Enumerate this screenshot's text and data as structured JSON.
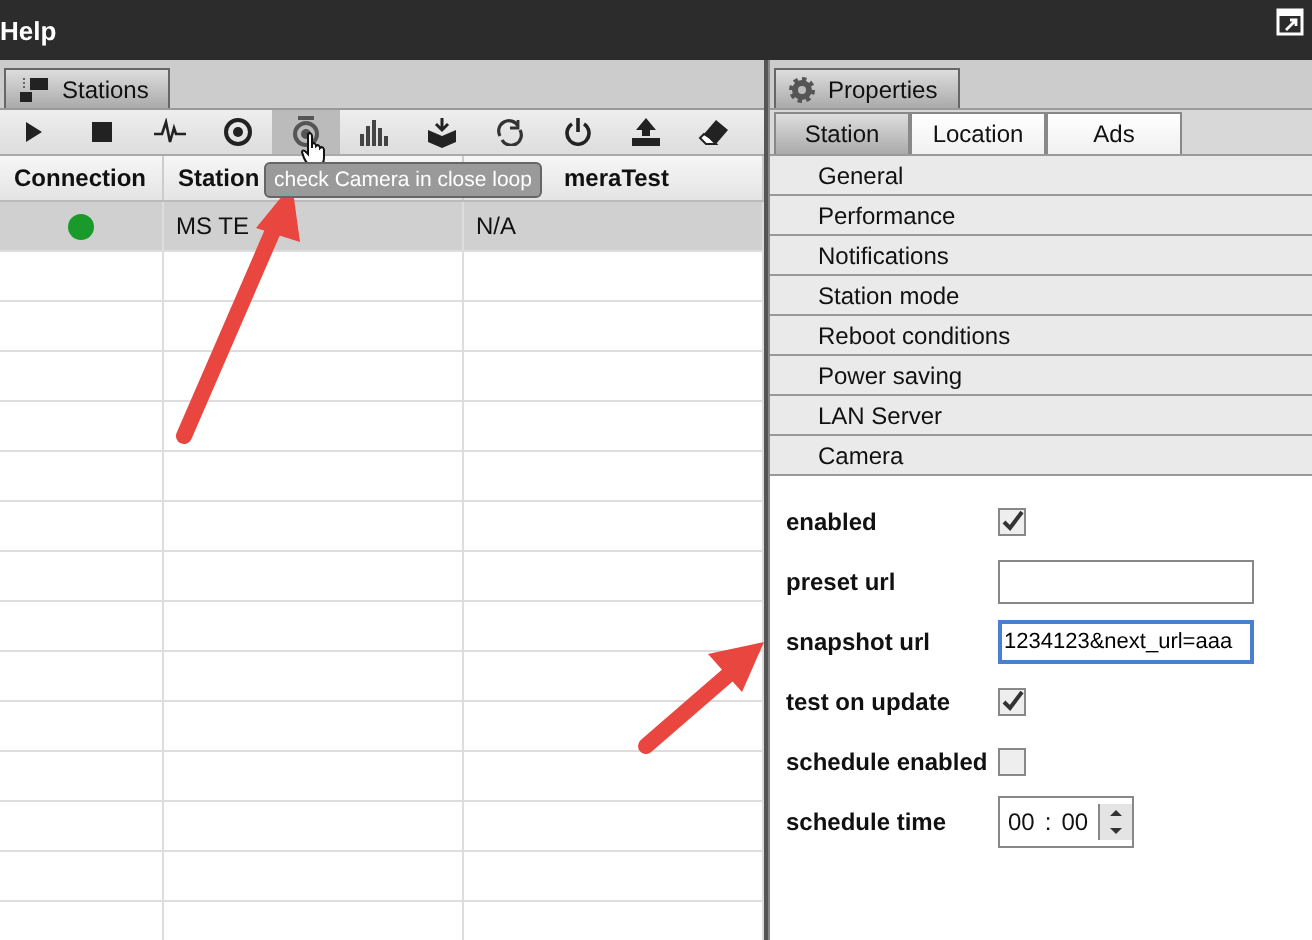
{
  "menu": [
    {
      "label": "Help"
    }
  ],
  "stations_panel": {
    "tab": "Stations",
    "toolbar": [
      {
        "kind": "play",
        "hovered": false
      },
      {
        "kind": "stop",
        "hovered": false
      },
      {
        "kind": "pulse",
        "hovered": false
      },
      {
        "kind": "camera",
        "hovered": false
      },
      {
        "kind": "camera-test",
        "hovered": true
      },
      {
        "kind": "bars",
        "hovered": false
      },
      {
        "kind": "box",
        "hovered": false
      },
      {
        "kind": "refresh",
        "hovered": false
      },
      {
        "kind": "power",
        "hovered": false
      },
      {
        "kind": "upload",
        "hovered": false
      },
      {
        "kind": "eraser",
        "hovered": false
      }
    ],
    "tooltip": "check Camera in close loop",
    "table": {
      "columns": [
        "Connection",
        "Station",
        "meraTest"
      ],
      "rows": [
        {
          "color": "#1a9a2a",
          "station": "MS TE",
          "camera_test": "N/A",
          "selected": true
        }
      ]
    }
  },
  "properties_panel": {
    "tab": "Properties",
    "tabs": [
      {
        "label": "Station",
        "selected": true
      },
      {
        "label": "Location",
        "selected": false
      },
      {
        "label": "Ads",
        "selected": false
      }
    ],
    "categories": [
      "General",
      "Performance",
      "Notifications",
      "Station mode",
      "Reboot conditions",
      "Power saving",
      "LAN Server",
      "Camera"
    ],
    "fields": [
      {
        "kind": "checkbox",
        "label": "enabled",
        "checked": true
      },
      {
        "kind": "text",
        "label": "preset url",
        "focused": false
      },
      {
        "kind": "text",
        "label": "snapshot url",
        "value": "1234123&next_url=aaa",
        "focused": true
      },
      {
        "kind": "checkbox",
        "label": "test on update",
        "checked": true
      },
      {
        "kind": "checkbox",
        "label": "schedule enabled",
        "checked": false
      },
      {
        "kind": "time",
        "label": "schedule time",
        "hours": "00",
        "separator": ":",
        "minutes": "00"
      }
    ]
  }
}
